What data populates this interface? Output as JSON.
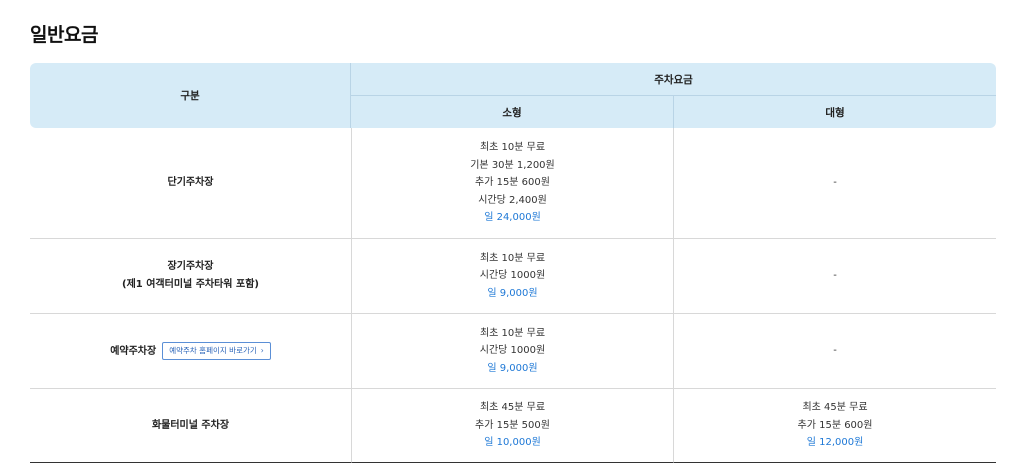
{
  "title": "일반요금",
  "header": {
    "category": "구분",
    "parking_fee": "주차요금",
    "small": "소형",
    "large": "대형"
  },
  "rows": [
    {
      "name": "단기주차장",
      "small": [
        "최초 10분 무료",
        "기본 30분 1,200원",
        "추가 15분 600원",
        "시간당 2,400원"
      ],
      "small_daily": "일 24,000원",
      "large": "-"
    },
    {
      "name": "장기주차장",
      "name_sub": "(제1 여객터미널 주차타워 포함)",
      "small": [
        "최초 10분 무료",
        "시간당 1000원"
      ],
      "small_daily": "일 9,000원",
      "large": "-"
    },
    {
      "name": "예약주차장",
      "button": "예약주차 홈페이지 바로가기",
      "button_icon": "chevron-right-icon",
      "small": [
        "최초 10분 무료",
        "시간당 1000원"
      ],
      "small_daily": "일 9,000원",
      "large": "-"
    },
    {
      "name": "화물터미널 주차장",
      "small": [
        "최초 45분 무료",
        "추가 15분 500원"
      ],
      "small_daily": "일 10,000원",
      "large": [
        "최초 45분 무료",
        "추가 15분 600원"
      ],
      "large_daily": "일 12,000원"
    }
  ],
  "colors": {
    "header_bg": "#d6ebf7",
    "daily_text": "#1e78d6",
    "button_border": "#5b8fd6"
  }
}
